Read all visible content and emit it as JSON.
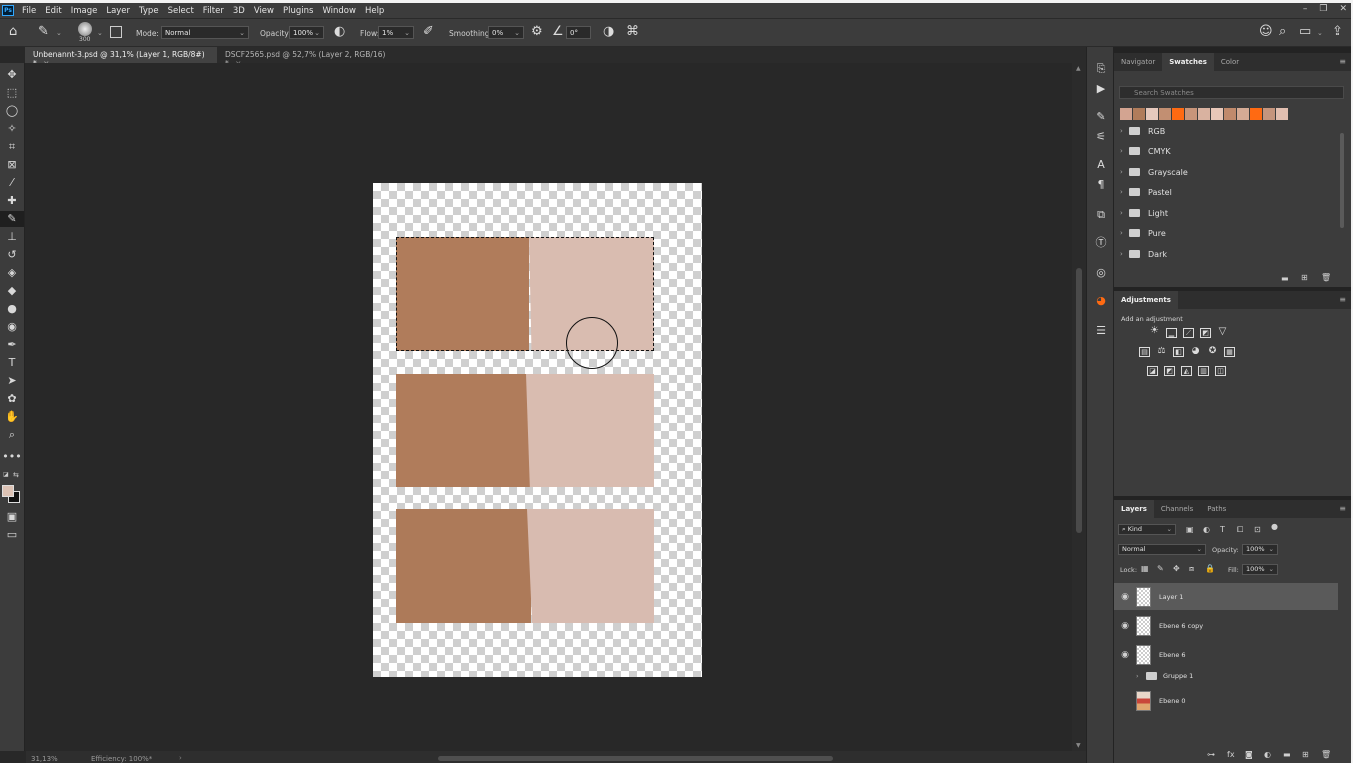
{
  "app": {
    "menu": [
      "File",
      "Edit",
      "Image",
      "Layer",
      "Type",
      "Select",
      "Filter",
      "3D",
      "View",
      "Plugins",
      "Window",
      "Help"
    ],
    "logo": "Ps"
  },
  "options_bar": {
    "brush_size": "300",
    "mode_label": "Mode:",
    "mode_value": "Normal",
    "opacity_label": "Opacity:",
    "opacity_value": "100%",
    "flow_label": "Flow:",
    "flow_value": "1%",
    "smoothing_label": "Smoothing:",
    "smoothing_value": "0%",
    "angle_value": "0°"
  },
  "tabs": [
    {
      "label": "Unbenannt-3.psd @ 31,1% (Layer 1, RGB/8#) *",
      "active": true
    },
    {
      "label": "DSCF2565.psd @ 52,7% (Layer 2, RGB/16) *",
      "active": false
    }
  ],
  "status_bar": {
    "zoom": "31,13%",
    "info": "Efficiency: 100%*"
  },
  "canvas": {
    "swatch_colors": {
      "brown": "#b07c5b",
      "pink": "#d9bcb0"
    }
  },
  "swatches_panel": {
    "tabs": [
      "Navigator",
      "Swatches",
      "Color"
    ],
    "active_tab": "Swatches",
    "search_placeholder": "Search Swatches",
    "recent": [
      "#d3a491",
      "#b07c5b",
      "#e6c9bd",
      "#c28f72",
      "#ff6a12",
      "#c8957a",
      "#d9b2a0",
      "#e8c7b8",
      "#c08a6c",
      "#d5ab95",
      "#ff6a12",
      "#c5957d",
      "#e2bfb0"
    ],
    "groups": [
      "RGB",
      "CMYK",
      "Grayscale",
      "Pastel",
      "Light",
      "Pure",
      "Dark"
    ]
  },
  "adjustments_panel": {
    "title": "Adjustments",
    "subtitle": "Add an adjustment"
  },
  "layers_panel": {
    "tabs": [
      "Layers",
      "Channels",
      "Paths"
    ],
    "active_tab": "Layers",
    "filter_kind": "Kind",
    "blend_mode": "Normal",
    "opacity_label": "Opacity:",
    "opacity_value": "100%",
    "lock_label": "Lock:",
    "fill_label": "Fill:",
    "fill_value": "100%",
    "layers": [
      {
        "name": "Layer 1",
        "visible": true,
        "selected": true
      },
      {
        "name": "Ebene 6 copy",
        "visible": true,
        "selected": false
      },
      {
        "name": "Ebene 6",
        "visible": true,
        "selected": false
      },
      {
        "name": "Gruppe 1",
        "visible": false,
        "selected": false,
        "type": "group"
      },
      {
        "name": "Ebene 0",
        "visible": false,
        "selected": false
      }
    ]
  }
}
